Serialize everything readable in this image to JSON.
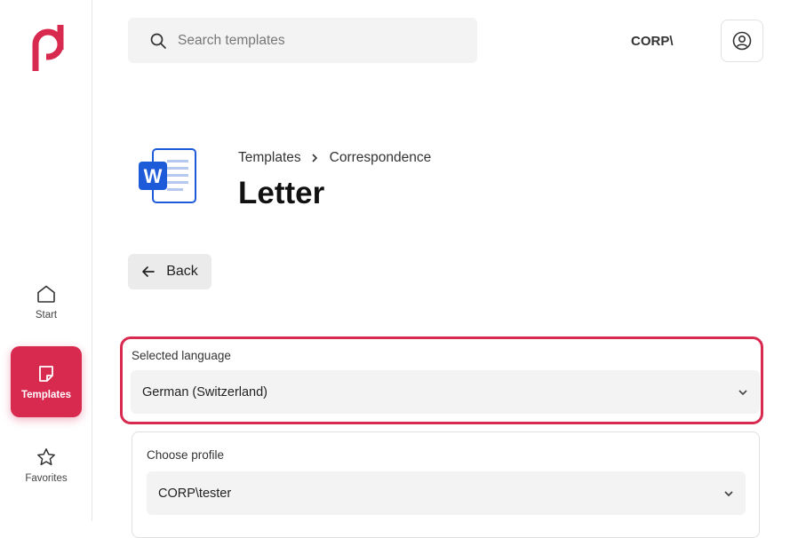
{
  "brand": {
    "logo_icon": "brand-logo",
    "accent": "#d8294f"
  },
  "sidebar": {
    "items": [
      {
        "label": "Start",
        "icon": "home-icon",
        "active": false
      },
      {
        "label": "Templates",
        "icon": "template-icon",
        "active": true
      },
      {
        "label": "Favorites",
        "icon": "star-icon",
        "active": false
      }
    ]
  },
  "header": {
    "search_placeholder": "Search templates",
    "account_label": "CORP\\",
    "user_icon": "user-icon"
  },
  "page": {
    "doc_icon": "word-document-icon",
    "breadcrumb": [
      "Templates",
      "Correspondence"
    ],
    "title": "Letter",
    "back_label": "Back"
  },
  "form": {
    "language": {
      "label": "Selected language",
      "value": "German (Switzerland)"
    },
    "profile": {
      "label": "Choose profile",
      "value": "CORP\\tester"
    }
  }
}
